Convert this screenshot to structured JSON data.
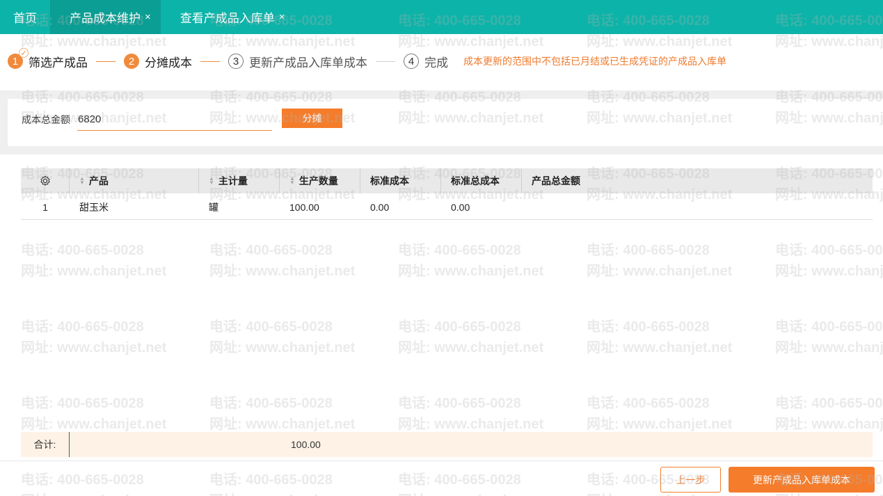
{
  "tabs": [
    {
      "label": "首页"
    },
    {
      "label": "产品成本维护",
      "close": "×"
    },
    {
      "label": "查看产成品入库单",
      "close": "×"
    }
  ],
  "steps": {
    "s1": {
      "num": "1",
      "label": "筛选产成品",
      "check": "✓"
    },
    "s2": {
      "num": "2",
      "label": "分摊成本"
    },
    "s3": {
      "num": "3",
      "label": "更新产成品入库单成本"
    },
    "s4": {
      "num": "4",
      "label": "完成"
    },
    "note": "成本更新的范围中不包括已月结或已生成凭证的产成品入库单"
  },
  "allocation": {
    "label": "成本总金额",
    "value": "6820",
    "button": "分摊"
  },
  "table": {
    "headers": [
      "产品",
      "主计量",
      "生产数量",
      "标准成本",
      "标准总成本",
      "产品总金额"
    ],
    "rows": [
      {
        "index": "1",
        "product": "甜玉米",
        "unit": "罐",
        "qty": "100.00",
        "std_cost": "0.00",
        "std_total": "0.00",
        "total": ""
      }
    ],
    "footer": {
      "label": "合计:",
      "qty_total": "100.00"
    }
  },
  "actions": {
    "prev": "上一步",
    "update": "更新产成品入库单成本"
  },
  "watermark": {
    "phone": "电话: 400-665-0028",
    "site": "网址: www.chanjet.net"
  },
  "colors": {
    "tab_bar": "#0cb3a8",
    "accent": "#f57c2a"
  }
}
